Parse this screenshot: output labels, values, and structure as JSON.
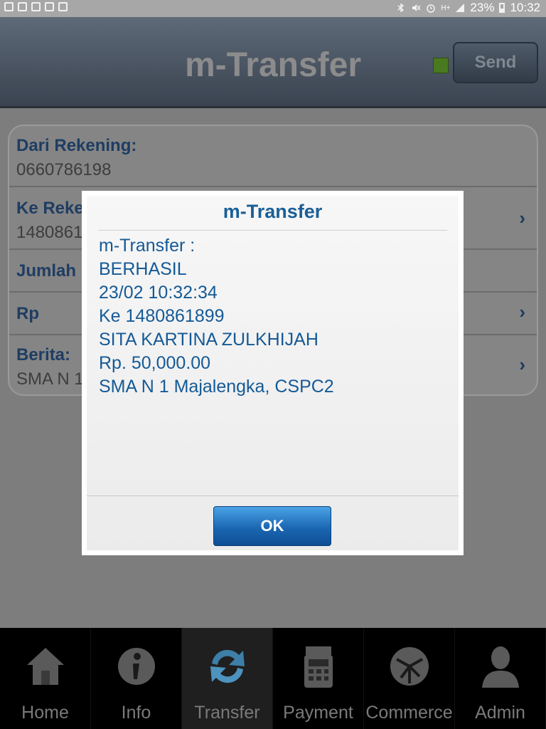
{
  "status_bar": {
    "battery_percent": "23%",
    "time": "10:32",
    "network": "H+"
  },
  "header": {
    "title": "m-Transfer",
    "send_label": "Send"
  },
  "form": {
    "from_account_label": "Dari Rekening:",
    "from_account_value": "0660786198",
    "to_account_label": "Ke Reke",
    "to_account_value": "1480861",
    "amount_label": "Jumlah U",
    "currency_label": "Rp",
    "message_label": "Berita:",
    "message_value": "SMA N 1"
  },
  "dialog": {
    "title": "m-Transfer",
    "lines": [
      "m-Transfer :",
      "BERHASIL",
      "23/02 10:32:34",
      "Ke 1480861899",
      "SITA KARTINA ZULKHIJAH",
      "Rp. 50,000.00",
      "SMA N 1 Majalengka, CSPC2"
    ],
    "ok_label": "OK"
  },
  "nav": {
    "items": [
      {
        "label": "Home",
        "icon": "home-icon"
      },
      {
        "label": "Info",
        "icon": "info-icon"
      },
      {
        "label": "Transfer",
        "icon": "transfer-icon"
      },
      {
        "label": "Payment",
        "icon": "payment-icon"
      },
      {
        "label": "Commerce",
        "icon": "commerce-icon"
      },
      {
        "label": "Admin",
        "icon": "admin-icon"
      }
    ],
    "active": "Transfer"
  }
}
